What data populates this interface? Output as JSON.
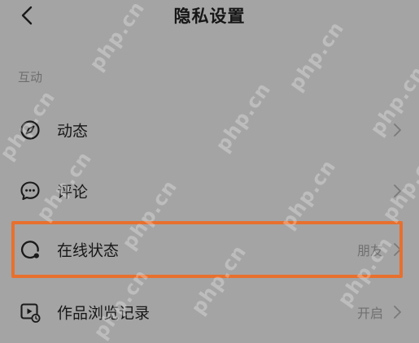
{
  "header": {
    "title": "隐私设置",
    "back_icon": "chevron-left-icon"
  },
  "section": {
    "label": "互动"
  },
  "items": [
    {
      "label": "动态",
      "value": "",
      "icon": "compass-icon"
    },
    {
      "label": "评论",
      "value": "",
      "icon": "chat-bubble-icon"
    },
    {
      "label": "在线状态",
      "value": "朋友",
      "icon": "online-status-icon"
    },
    {
      "label": "作品浏览记录",
      "value": "开启",
      "icon": "video-history-icon"
    }
  ],
  "highlight": {
    "color": "#e8702e",
    "target": "在线状态"
  },
  "watermark": {
    "text": "php.cn"
  },
  "colors": {
    "background": "#a4a4a4",
    "text": "#161616",
    "muted": "#707070"
  }
}
